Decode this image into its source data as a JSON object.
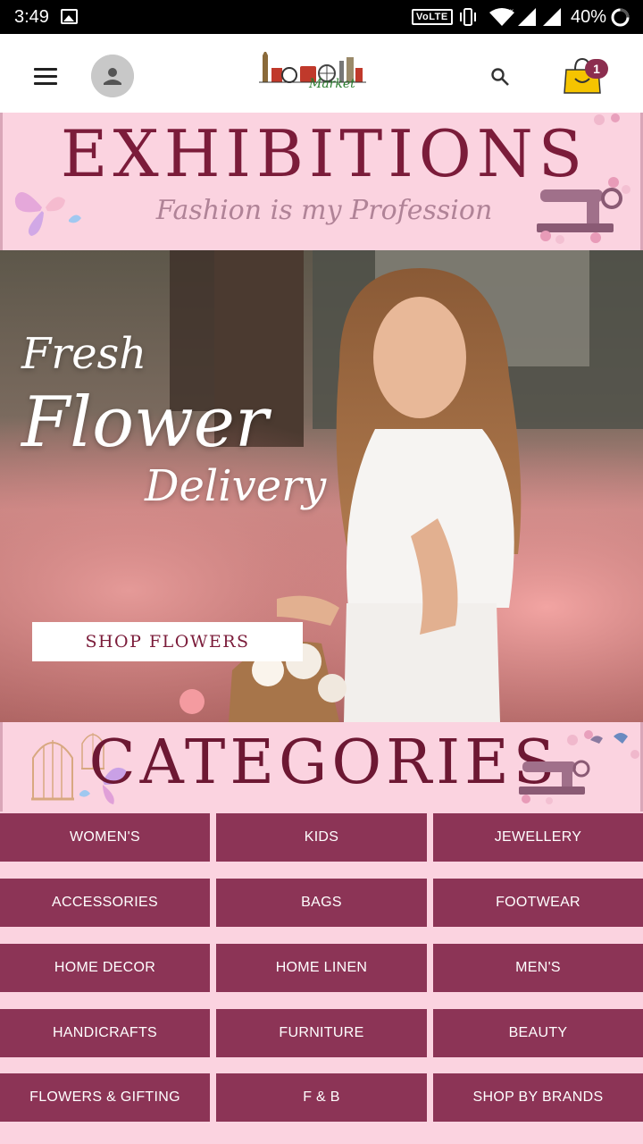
{
  "status_bar": {
    "time": "3:49",
    "network_badge": "VoLTE",
    "battery": "40%"
  },
  "app_bar": {
    "logo_text": "Market",
    "cart_count": "1",
    "icons": [
      "menu-icon",
      "account-icon",
      "search-icon",
      "shopping-bag-icon"
    ]
  },
  "exhibitions": {
    "title": "EXHIBITIONS",
    "subtitle": "Fashion is my Profession"
  },
  "hero": {
    "script_line1": "Fresh",
    "script_line2": "Flower",
    "script_line3": "Delivery",
    "button_label": "SHOP FLOWERS"
  },
  "categories": {
    "title": "CATEGORIES",
    "items": [
      "WOMEN'S",
      "KIDS",
      "JEWELLERY",
      "ACCESSORIES",
      "BAGS",
      "FOOTWEAR",
      "HOME DECOR",
      "HOME LINEN",
      "MEN'S",
      "HANDICRAFTS",
      "FURNITURE",
      "BEAUTY",
      "FLOWERS & GIFTING",
      "F & B",
      "SHOP BY BRANDS"
    ]
  },
  "colors": {
    "brand_maroon": "#7b1c3a",
    "category_button": "#8c3456",
    "pink_background": "#fbd3e0",
    "cart_yellow": "#f5c400"
  }
}
